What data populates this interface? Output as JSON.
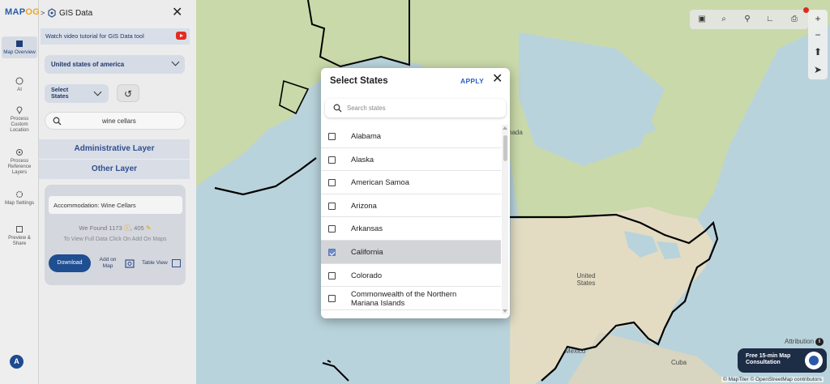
{
  "app": {
    "logo_main": "MAP",
    "logo_accent": "OG",
    "panel_title": "GIS Data",
    "close_glyph": "✕",
    "breadcrumb_chevron": ">"
  },
  "rail": {
    "items": [
      {
        "label": "Map Overview",
        "icon": "map-icon"
      },
      {
        "label": "AI",
        "icon": "ai-icon"
      },
      {
        "label": "Process Custom Location",
        "icon": "location-pin-icon"
      },
      {
        "label": "Process Reference Layers",
        "icon": "layers-icon"
      },
      {
        "label": "Map Settings",
        "icon": "gear-icon"
      },
      {
        "label": "Preview & Share",
        "icon": "share-icon"
      }
    ],
    "avatar_letter": "A"
  },
  "panel": {
    "tutorial_text": "Watch video tutorial for GIS Data tool",
    "country_value": "United states of america",
    "states_button": "Select States",
    "search_value": "wine cellars",
    "administrative_layer": "Administrative Layer",
    "other_layer": "Other Layer",
    "result": {
      "name": "Accommodation: Wine Cellars",
      "found_prefix": "We Found",
      "count_a": "1173",
      "count_b": "405",
      "hint": "To View Full Data Click On Add On Maps",
      "download_label": "Download",
      "add_on_map_label": "Add on Map",
      "table_view_label": "Table View"
    }
  },
  "modal": {
    "title": "Select States",
    "apply_label": "APPLY",
    "close_glyph": "✕",
    "search_placeholder": "Search states",
    "states": [
      {
        "label": "Alabama",
        "checked": false
      },
      {
        "label": "Alaska",
        "checked": false
      },
      {
        "label": "American Samoa",
        "checked": false
      },
      {
        "label": "Arizona",
        "checked": false
      },
      {
        "label": "Arkansas",
        "checked": false
      },
      {
        "label": "California",
        "checked": true
      },
      {
        "label": "Colorado",
        "checked": false
      },
      {
        "label": "Commonwealth of the Northern Mariana Islands",
        "checked": false
      }
    ]
  },
  "map": {
    "labels": {
      "canada_partial": "nada",
      "united_states": "United States",
      "mexico": "Mexico",
      "cuba": "Cuba"
    },
    "attribution": "Attribution",
    "consult": "Free 15-min Map Consultation",
    "credits": "© MapTiler © OpenStreetMap contributors",
    "colors": {
      "water": "#b9d3dc",
      "land_green": "#c9d9a9",
      "land_tan": "#e3dcc3",
      "border": "#000000",
      "accent": "#1f4e91"
    }
  }
}
